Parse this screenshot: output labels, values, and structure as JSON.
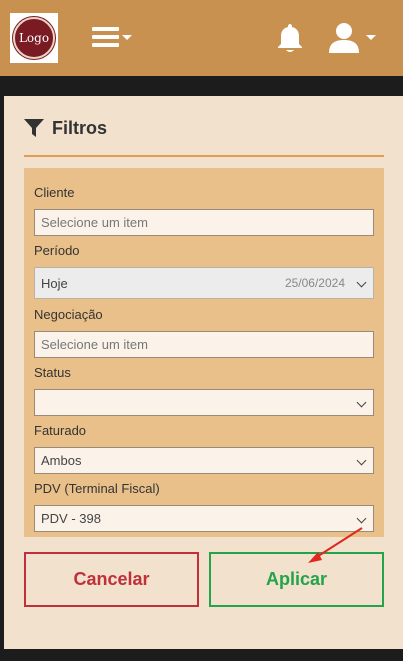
{
  "header": {
    "logo_text": "Logo",
    "menu_icon": "hamburger-menu-icon",
    "bell_icon": "bell-icon",
    "user_icon": "user-icon",
    "bar_color": "#c8914f"
  },
  "filters": {
    "title": "Filtros",
    "icon": "filter-icon",
    "fields": {
      "cliente": {
        "label": "Cliente",
        "placeholder": "Selecione um item"
      },
      "periodo": {
        "label": "Período",
        "value": "Hoje",
        "date": "25/06/2024"
      },
      "negociacao": {
        "label": "Negociação",
        "placeholder": "Selecione um item"
      },
      "status": {
        "label": "Status",
        "value": ""
      },
      "faturado": {
        "label": "Faturado",
        "value": "Ambos"
      },
      "pdv": {
        "label": "PDV (Terminal Fiscal)",
        "value": "PDV - 398"
      }
    },
    "cancel_label": "Cancelar",
    "apply_label": "Aplicar",
    "cancel_color": "#c0303a",
    "apply_color": "#23a34a",
    "annotation_color": "#e0281e"
  }
}
